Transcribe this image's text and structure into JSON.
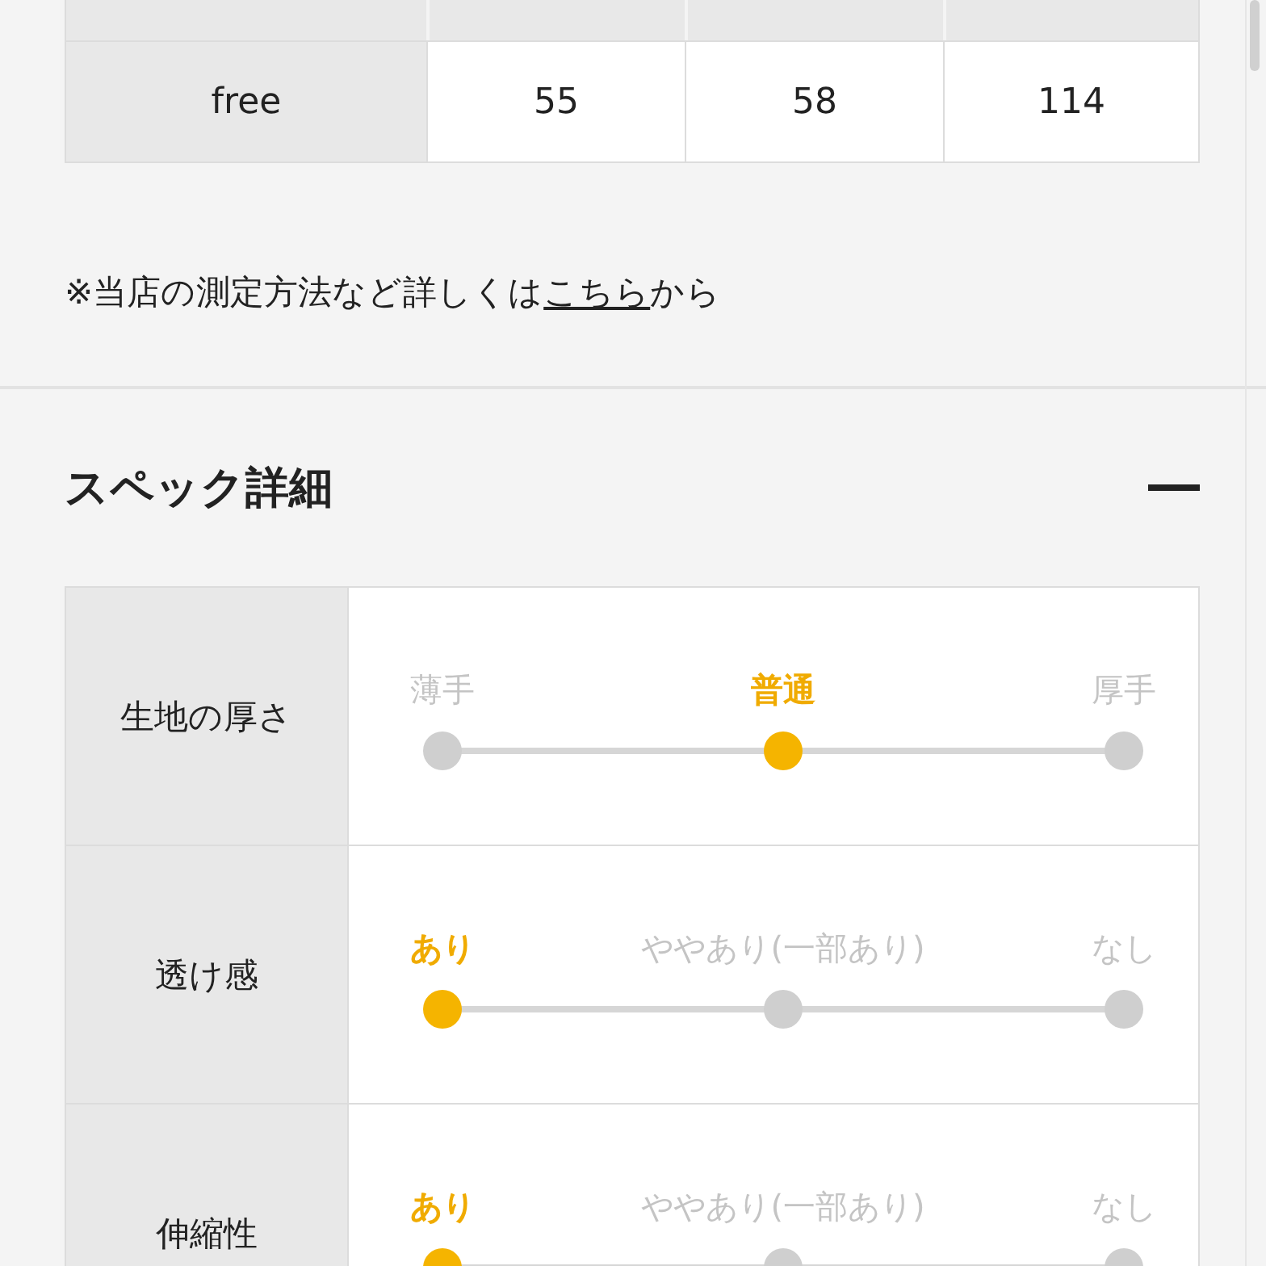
{
  "size_table": {
    "rows": [
      {
        "cells": [
          "free",
          "55",
          "58",
          "114"
        ]
      }
    ]
  },
  "note": {
    "before": "※当店の測定方法など詳しくは",
    "link": "こちら",
    "after": "から"
  },
  "spec_section": {
    "title": "スペック詳細",
    "expanded": true,
    "specs": [
      {
        "label": "生地の厚さ",
        "options": [
          {
            "label": "薄手",
            "selected": false
          },
          {
            "label": "普通",
            "selected": true
          },
          {
            "label": "厚手",
            "selected": false
          }
        ]
      },
      {
        "label": "透け感",
        "options": [
          {
            "label": "あり",
            "selected": true
          },
          {
            "label": "ややあり(一部あり)",
            "selected": false
          },
          {
            "label": "なし",
            "selected": false
          }
        ]
      },
      {
        "label": "伸縮性",
        "options": [
          {
            "label": "あり",
            "selected": true
          },
          {
            "label": "ややあり(一部あり)",
            "selected": false
          },
          {
            "label": "なし",
            "selected": false
          }
        ]
      }
    ]
  }
}
